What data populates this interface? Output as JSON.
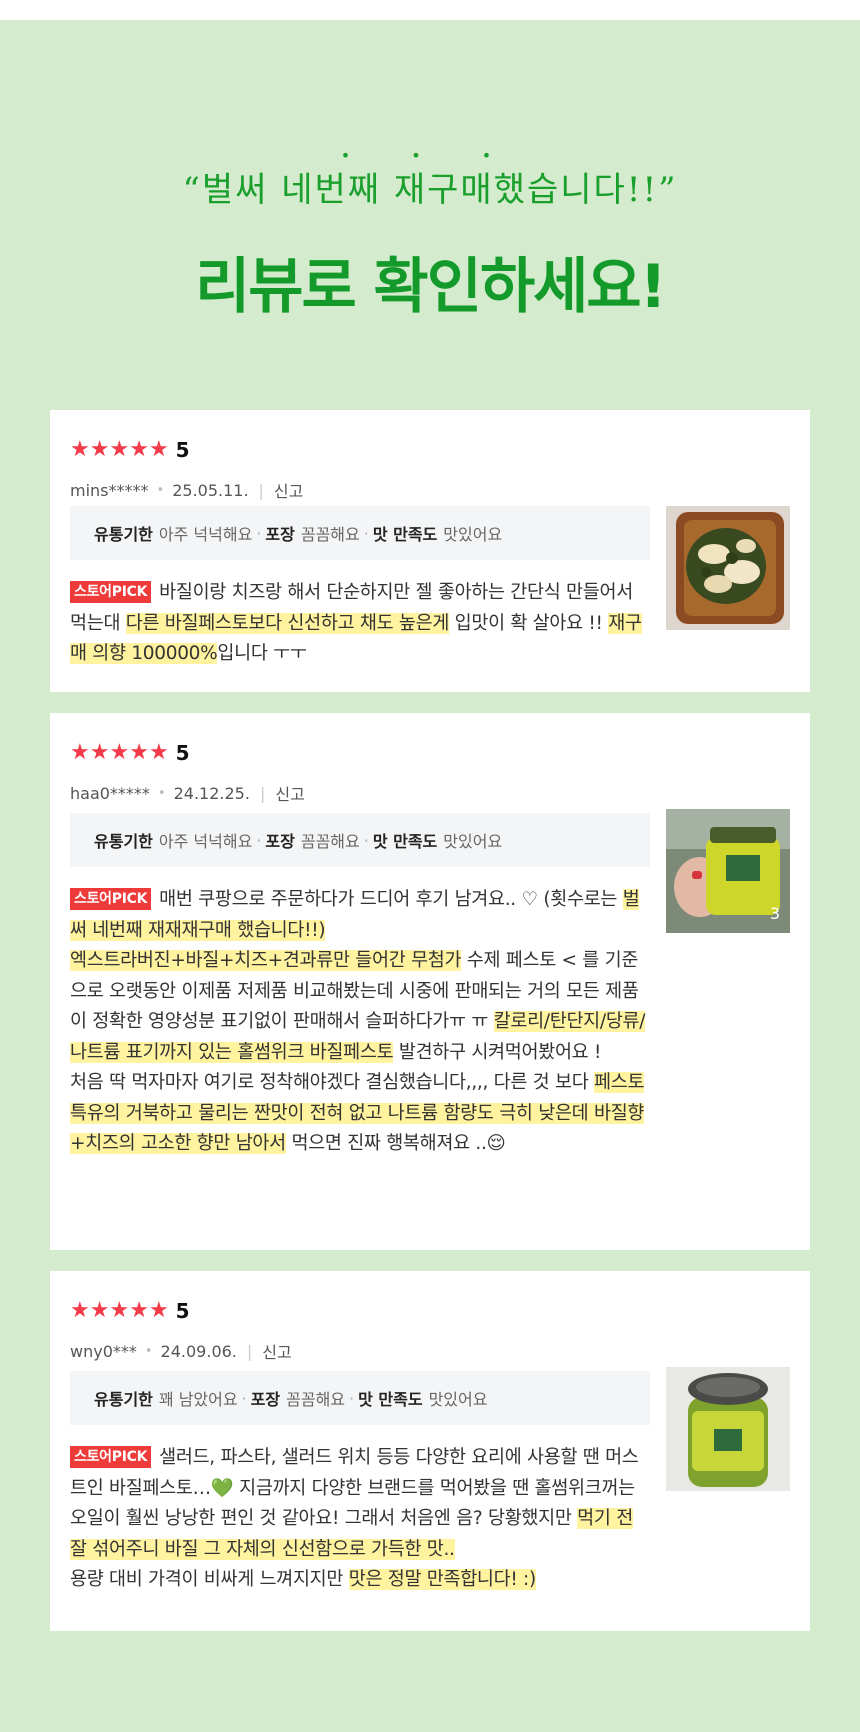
{
  "header": {
    "dots": "• • •",
    "quote": "“벌써 네번째 재구매했습니다!!”",
    "title": "리뷰로 확인하세요!"
  },
  "colors": {
    "background": "#d4eccd",
    "headline": "#149a2a",
    "star": "#f43b4a",
    "pick_badge": "#ef3a3a",
    "highlight": "#fff3a0"
  },
  "reviews": [
    {
      "rating_stars": 5,
      "score": "5",
      "user": "mins*****",
      "date": "25.05.11.",
      "report": "신고",
      "attrs": [
        {
          "key": "유통기한",
          "val": "아주 넉넉해요"
        },
        {
          "key": "포장",
          "val": "꼼꼼해요"
        },
        {
          "key": "맛 만족도",
          "val": "맛있어요"
        }
      ],
      "badge": "스토어PICK",
      "segments": [
        {
          "text": "바질이랑 치즈랑 해서 단순하지만 젤 좋아하는 간단식 만들어서 먹는대 ",
          "hl": false
        },
        {
          "text": "다른 바질페스토보다 신선하고 채도 높은게",
          "hl": true
        },
        {
          "text": " 입맛이 확 살아요 !! ",
          "hl": false
        },
        {
          "text": "재구매 의향 100000%",
          "hl": true
        },
        {
          "text": "입니다 ㅜㅜ",
          "hl": false
        }
      ],
      "photo": "toast-photo",
      "photo_count": ""
    },
    {
      "rating_stars": 5,
      "score": "5",
      "user": "haa0*****",
      "date": "24.12.25.",
      "report": "신고",
      "attrs": [
        {
          "key": "유통기한",
          "val": "아주 넉넉해요"
        },
        {
          "key": "포장",
          "val": "꼼꼼해요"
        },
        {
          "key": "맛 만족도",
          "val": "맛있어요"
        }
      ],
      "badge": "스토어PICK",
      "segments": [
        {
          "text": "매번 쿠팡으로 주문하다가 드디어 후기 남겨요.. ♡ (횟수로는 ",
          "hl": false
        },
        {
          "text": "벌써 네번째 재재재구매 했습니다!!)",
          "hl": true
        },
        {
          "text": "\n",
          "hl": false
        },
        {
          "text": "엑스트라버진+바질+치즈+견과류만 들어간 무첨가",
          "hl": true
        },
        {
          "text": " 수제 페스토 < 를 기준으로 오랫동안 이제품 저제품 비교해봤는데 시중에 판매되는 거의 모든 제품이 정확한 영양성분 표기없이 판매해서 슬퍼하다가ㅠ ㅠ ",
          "hl": false
        },
        {
          "text": "칼로리/탄단지/당류/나트륨 표기까지 있는 홀썸위크 바질페스토",
          "hl": true
        },
        {
          "text": " 발견하구 시켜먹어봤어요 !\n처음 딱 먹자마자 여기로 정착해야겠다 결심했습니다,,,, 다른 것 보다 ",
          "hl": false
        },
        {
          "text": "페스토 특유의 거북하고 물리는 짠맛이 전혀 없고 나트륨 함량도 극히 낮은데 바질향+치즈의 고소한 향만 남아서",
          "hl": true
        },
        {
          "text": " 먹으면 진짜 행복해져요 ..😌",
          "hl": false
        }
      ],
      "photo": "jar-in-hand-photo",
      "photo_count": "3"
    },
    {
      "rating_stars": 5,
      "score": "5",
      "user": "wny0***",
      "date": "24.09.06.",
      "report": "신고",
      "attrs": [
        {
          "key": "유통기한",
          "val": "꽤 남았어요"
        },
        {
          "key": "포장",
          "val": "꼼꼼해요"
        },
        {
          "key": "맛 만족도",
          "val": "맛있어요"
        }
      ],
      "badge": "스토어PICK",
      "segments": [
        {
          "text": "샐러드, 파스타, 샐러드 위치 등등 다양한 요리에 사용할 땐 머스트인 바질페스토…💚 지금까지 다양한 브랜드를 먹어봤을 땐 홀썸위크꺼는 오일이 훨씬 낭낭한 편인 것 같아요! 그래서 처음엔 음? 당황했지만 ",
          "hl": false
        },
        {
          "text": "먹기 전 잘 섞어주니 바질 그 자체의 신선함으로 가득한 맛..",
          "hl": true
        },
        {
          "text": "\n용량 대비 가격이 비싸게 느껴지지만 ",
          "hl": false
        },
        {
          "text": "맛은 정말 만족합니다! :)",
          "hl": true
        }
      ],
      "photo": "jar-photo",
      "photo_count": ""
    }
  ]
}
